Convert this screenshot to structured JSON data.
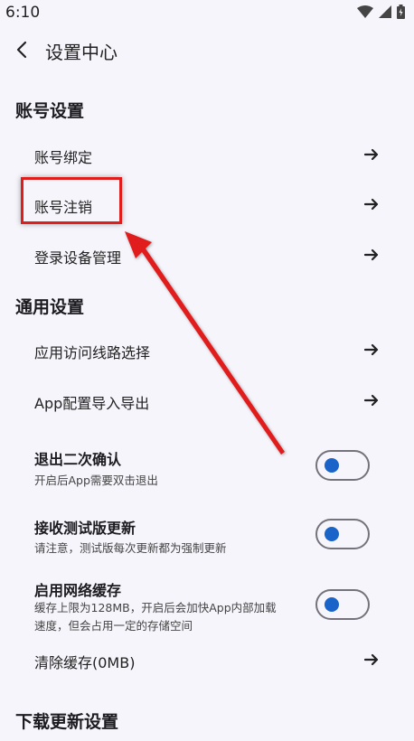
{
  "status": {
    "time": "6:10"
  },
  "header": {
    "title": "设置中心"
  },
  "sections": {
    "account": {
      "title": "账号设置",
      "items": [
        {
          "label": "账号绑定"
        },
        {
          "label": "账号注销"
        },
        {
          "label": "登录设备管理"
        }
      ]
    },
    "general": {
      "title": "通用设置",
      "items": [
        {
          "label": "应用访问线路选择"
        },
        {
          "label": "App配置导入导出"
        }
      ],
      "toggles": [
        {
          "title": "退出二次确认",
          "desc": "开启后App需要双击退出",
          "on": false
        },
        {
          "title": "接收测试版更新",
          "desc": "请注意，测试版每次更新都为强制更新",
          "on": false
        },
        {
          "title": "启用网络缓存",
          "desc": "缓存上限为128MB，开启后会加快App内部加载速度，但会占用一定的存储空间",
          "on": false
        }
      ],
      "clear_cache": {
        "label": "清除缓存(0MB)"
      }
    },
    "download": {
      "title": "下载更新设置"
    }
  },
  "annotation": {
    "color": "#e11c1c"
  }
}
